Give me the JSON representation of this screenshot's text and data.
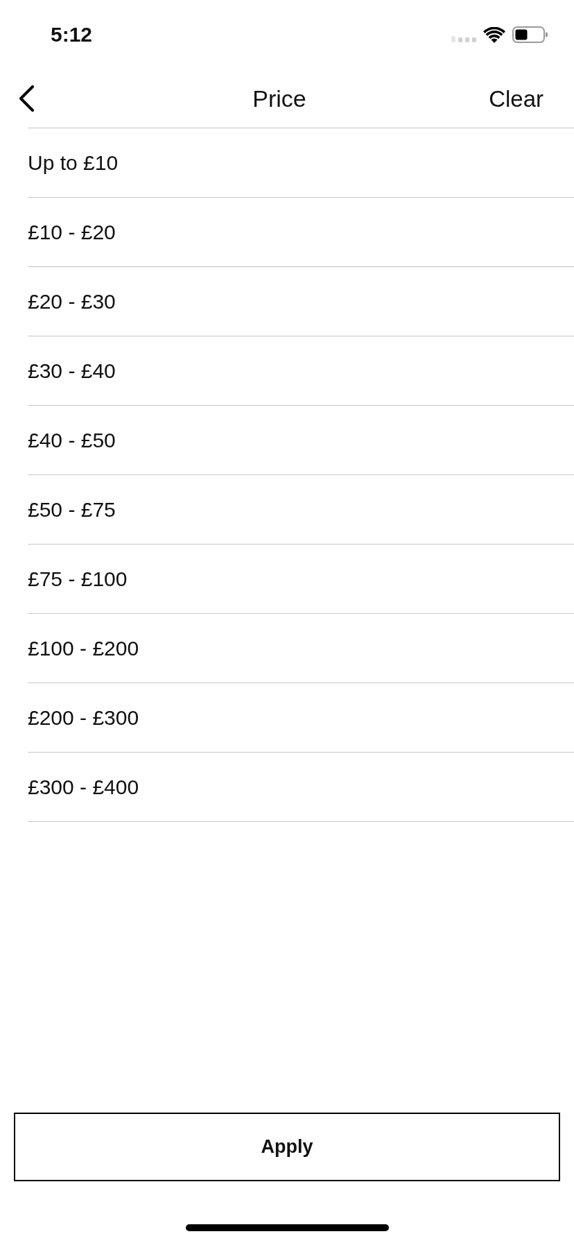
{
  "status_bar": {
    "time": "5:12"
  },
  "nav_bar": {
    "title": "Price",
    "clear_button": "Clear"
  },
  "price_ranges": [
    {
      "label": "Up to £10",
      "selected": false
    },
    {
      "label": "£10 - £20",
      "selected": false
    },
    {
      "label": "£20 - £30",
      "selected": false
    },
    {
      "label": "£30 - £40",
      "selected": false
    },
    {
      "label": "£40 - £50",
      "selected": false
    },
    {
      "label": "£50 - £75",
      "selected": false
    },
    {
      "label": "£75 - £100",
      "selected": false
    },
    {
      "label": "£100 - £200",
      "selected": false
    },
    {
      "label": "£200 - £300",
      "selected": false
    },
    {
      "label": "£300 - £400",
      "selected": false
    }
  ],
  "apply_button": "Apply"
}
